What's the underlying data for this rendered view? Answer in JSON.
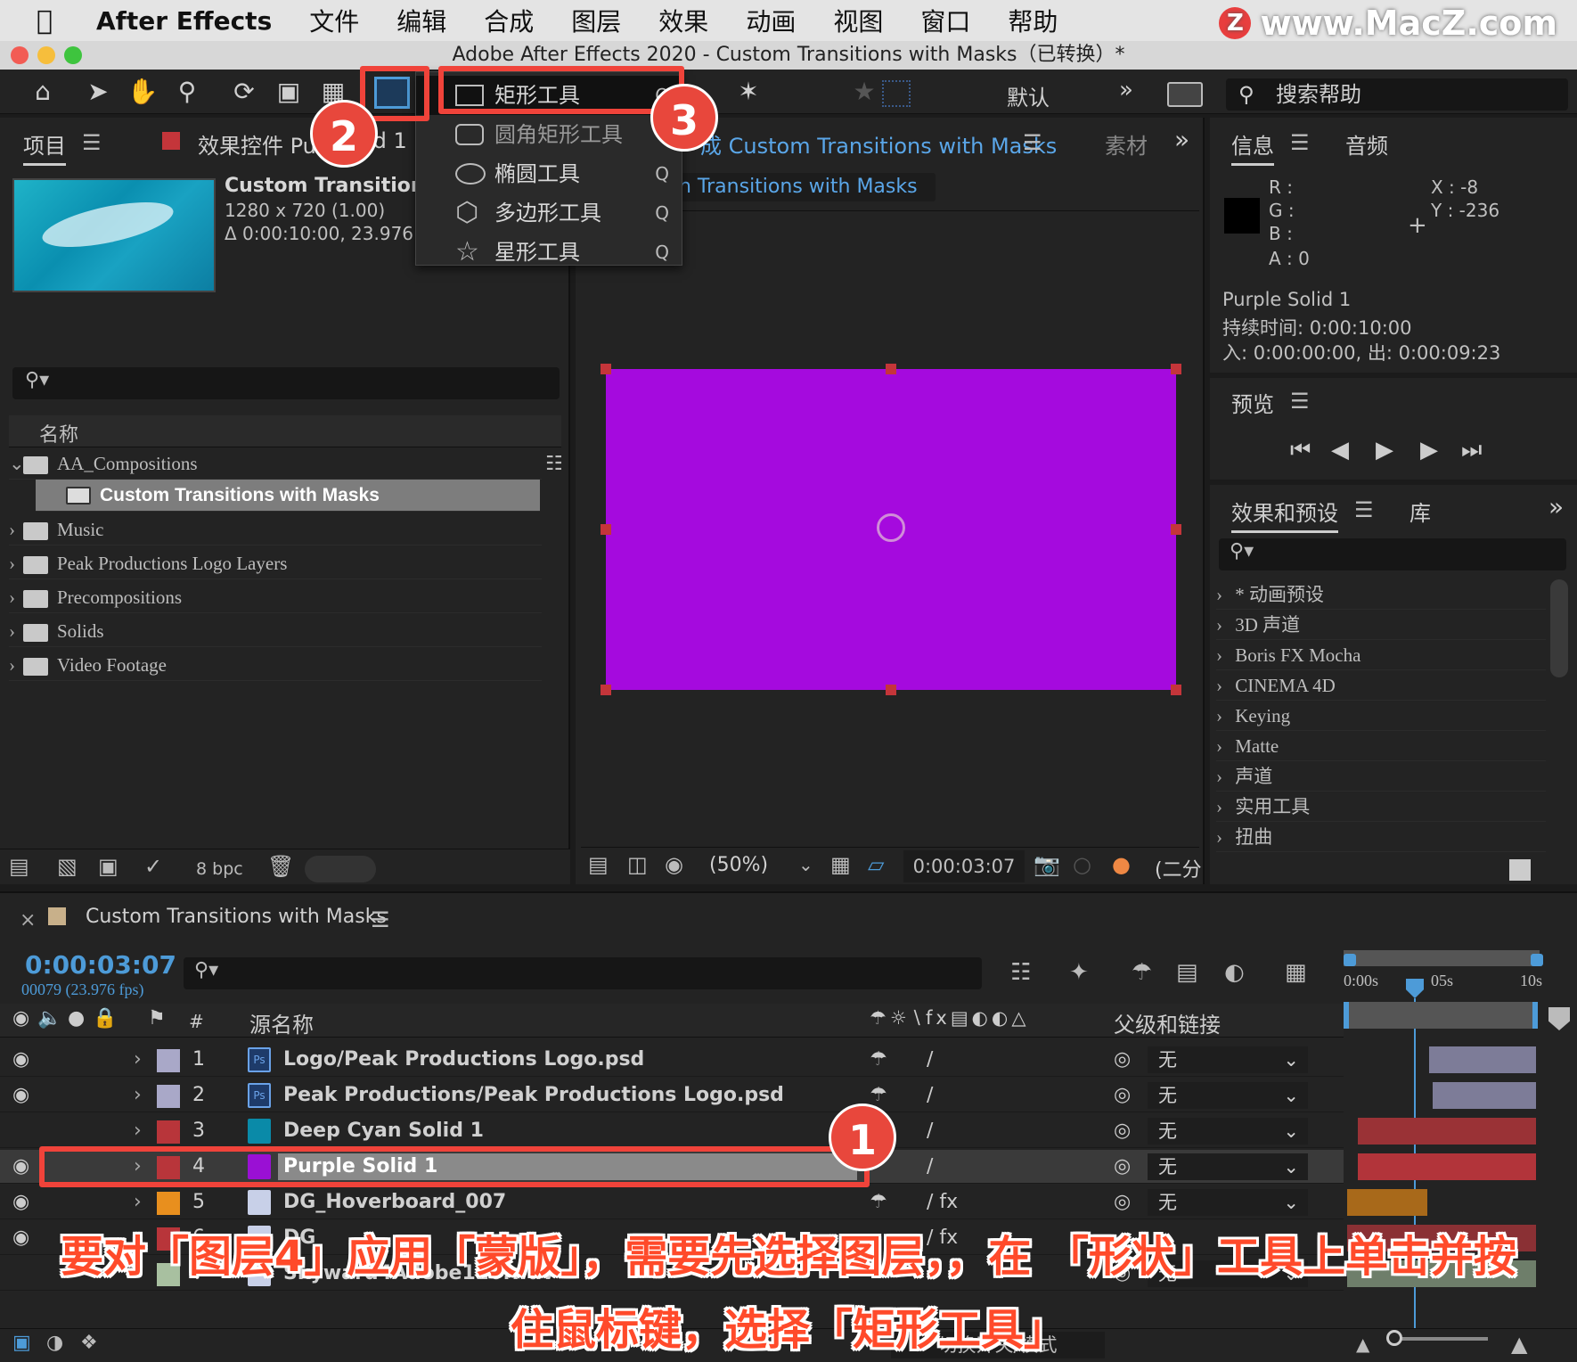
{
  "menubar": {
    "app_name": "After Effects",
    "items": [
      "文件",
      "编辑",
      "合成",
      "图层",
      "效果",
      "动画",
      "视图",
      "窗口",
      "帮助"
    ],
    "watermark": "www.MacZ.com",
    "watermark_logo": "Z"
  },
  "window": {
    "title": "Adobe After Effects 2020 - Custom Transitions with Masks（已转换）*"
  },
  "toolbar": {
    "workspace": "默认",
    "search_placeholder": "搜索帮助"
  },
  "shape_menu": {
    "items": [
      {
        "label": "矩形工具",
        "key": "Q"
      },
      {
        "label": "圆角矩形工具",
        "key": ""
      },
      {
        "label": "椭圆工具",
        "key": "Q"
      },
      {
        "label": "多边形工具",
        "key": "Q"
      },
      {
        "label": "星形工具",
        "key": "Q"
      }
    ]
  },
  "project_panel": {
    "tab": "项目",
    "effects_tab": "效果控件 Pu",
    "effects_tab_tail": "id 1",
    "comp_name": "Custom Transitions",
    "resolution": "1280 x 720 (1.00)",
    "duration": "Δ 0:00:10:00, 23.976 fps",
    "col_name": "名称",
    "tree": [
      {
        "label": "AA_Compositions",
        "expanded": true
      },
      {
        "label": "Custom Transitions with Masks",
        "child": true,
        "selected": true
      },
      {
        "label": "Music"
      },
      {
        "label": "Peak Productions Logo Layers"
      },
      {
        "label": "Precompositions"
      },
      {
        "label": "Solids"
      },
      {
        "label": "Video Footage"
      }
    ],
    "bpc": "8 bpc"
  },
  "comp_panel": {
    "tab": "成 Custom Transitions with Masks",
    "tab_other": "素材",
    "subtab": "n Transitions with Masks",
    "zoom": "(50%)",
    "timecode": "0:00:03:07",
    "resolution": "(二分",
    "solid_color": "#a50ade"
  },
  "info_panel": {
    "tab": "信息",
    "tab2": "音频",
    "r": "R :",
    "g": "G :",
    "b": "B :",
    "a": "A :  0",
    "x": "X : -8",
    "y": "Y : -236",
    "layer": "Purple Solid 1",
    "duration": "持续时间: 0:00:10:00",
    "inout": "入: 0:00:00:00,  出: 0:00:09:23"
  },
  "preview_panel": {
    "tab": "预览"
  },
  "effects_panel": {
    "tab": "效果和预设",
    "tab2": "库",
    "items": [
      "* 动画预设",
      "3D 声道",
      "Boris FX Mocha",
      "CINEMA 4D",
      "Keying",
      "Matte",
      "声道",
      "实用工具",
      "扭曲"
    ]
  },
  "timeline": {
    "tab": "Custom Transitions with Masks",
    "timecode": "0:00:03:07",
    "frames": "00079 (23.976 fps)",
    "col_num": "#",
    "col_source": "源名称",
    "col_parent": "父级和链接",
    "ruler": [
      "0:00s",
      "05s",
      "10s"
    ],
    "layers": [
      {
        "num": "1",
        "name": "Logo/Peak Productions Logo.psd",
        "label_color": "#a9a8c8",
        "icon": "Ps",
        "parent": "无"
      },
      {
        "num": "2",
        "name": "Peak Productions/Peak Productions Logo.psd",
        "label_color": "#a9a8c8",
        "icon": "Ps",
        "parent": "无"
      },
      {
        "num": "3",
        "name": "Deep Cyan Solid 1",
        "label_color": "#b8353a",
        "icon": "",
        "icon_color": "#0a8aa8",
        "parent": "无"
      },
      {
        "num": "4",
        "name": "Purple Solid 1",
        "label_color": "#b8353a",
        "icon": "",
        "icon_color": "#9a10d4",
        "parent": "无"
      },
      {
        "num": "5",
        "name": "DG_Hoverboard_007",
        "label_color": "#e88f1e",
        "icon": "",
        "icon_color": "#c8d0e8",
        "parent": "无"
      },
      {
        "num": "6",
        "name": "DG",
        "label_color": "#b8353a",
        "icon": "",
        "icon_color": "#c8d0e8",
        "parent": ""
      },
      {
        "num": "7",
        "name": "Skyward4Adobe120.wav",
        "label_color": "#a8c0a0",
        "icon": "",
        "icon_color": "#c8d0e8",
        "parent": "无"
      }
    ],
    "footer": "切换开关/模式"
  },
  "annotations": {
    "badge1": "1",
    "badge2": "2",
    "badge3": "3",
    "caption_line1": "要对「图层4」应用「蒙版」，需要先选择图层，，在 「形状」工具上单击并按",
    "caption_line2": "住鼠标键，选择「矩形工具」"
  }
}
